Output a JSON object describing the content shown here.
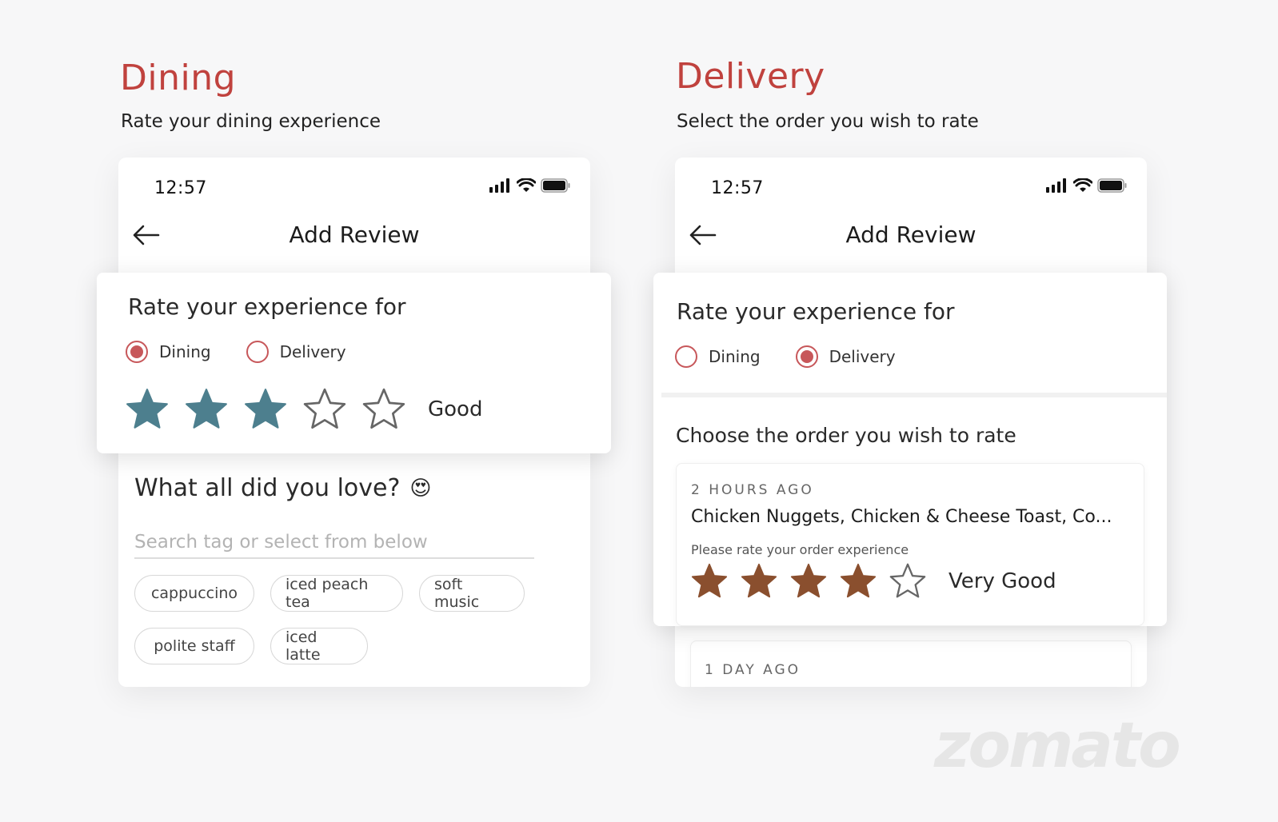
{
  "dining": {
    "title": "Dining",
    "subtitle": "Rate your dining experience",
    "status_time": "12:57",
    "screen_title": "Add Review",
    "card_heading": "Rate your experience for",
    "radio_dining": "Dining",
    "radio_delivery": "Delivery",
    "selected": "dining",
    "rating": 3,
    "rating_max": 5,
    "rating_label": "Good",
    "star_color": "#4d7f8e",
    "love_heading": "What all did you love?",
    "love_emoji": "😍",
    "search_placeholder": "Search tag or select from below",
    "tags": [
      "cappuccino",
      "iced peach tea",
      "soft music",
      "polite staff",
      "iced latte"
    ]
  },
  "delivery": {
    "title": "Delivery",
    "subtitle": "Select the order you wish to rate",
    "status_time": "12:57",
    "screen_title": "Add Review",
    "card_heading": "Rate your experience for",
    "radio_dining": "Dining",
    "radio_delivery": "Delivery",
    "selected": "delivery",
    "choose_heading": "Choose the order you wish to rate",
    "orders": [
      {
        "time": "2 HOURS AGO",
        "items": "Chicken Nuggets, Chicken & Cheese Toast, Co...",
        "prompt": "Please rate your order experience",
        "rating": 4,
        "rating_label": "Very Good"
      },
      {
        "time": "1 DAY AGO"
      }
    ],
    "star_color": "#8a4f2e"
  },
  "brand": {
    "accent": "#c0423e",
    "radio_color": "#c7575a",
    "watermark": "zomato"
  }
}
